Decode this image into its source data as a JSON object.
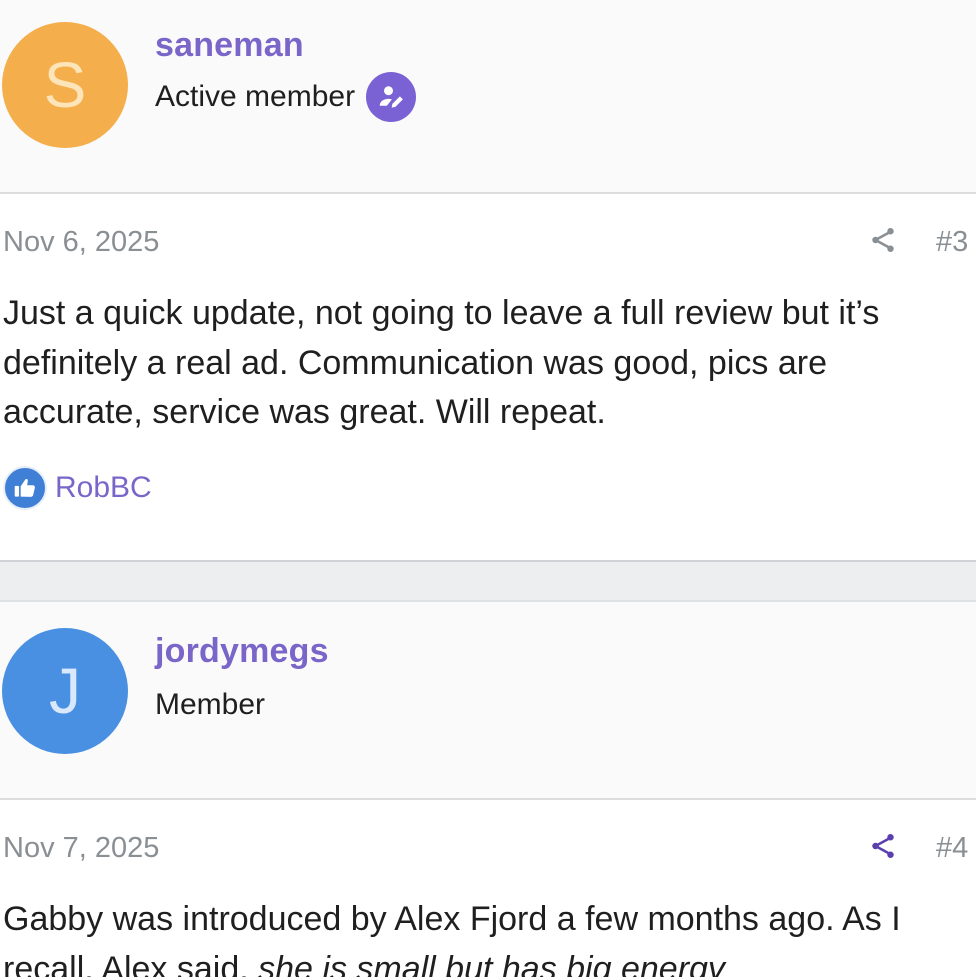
{
  "posts": [
    {
      "user": {
        "initial": "S",
        "avatar_color": "#f4ae4c",
        "avatar_text_color": "#fde5b9",
        "name": "saneman",
        "title": "Active member",
        "badge_icon": "user-edit-icon",
        "badge_color": "#7b62d4"
      },
      "date": "Nov 6, 2025",
      "share_icon": "share-icon",
      "number": "#3",
      "text_lines": [
        "Just a quick update, not going to leave a full review but it’s",
        "definitely a real ad. Communication was good, pics are",
        "accurate, service was great. Will repeat."
      ],
      "reaction": {
        "icon": "thumbs-up-icon",
        "user": "RobBC"
      }
    },
    {
      "user": {
        "initial": "J",
        "avatar_color": "#4a90e2",
        "avatar_text_color": "#d9e8fb",
        "name": "jordymegs",
        "title": "Member"
      },
      "date": "Nov 7, 2025",
      "share_icon": "share-icon",
      "number": "#4",
      "text_line_1": "Gabby was introduced by Alex Fjord a few months ago. As I",
      "text_line_2_start": "recall, Alex said, ",
      "text_line_2_italic": "she is small but has big energy"
    }
  ],
  "colors": {
    "link_purple": "#7a65c9",
    "meta_gray": "#8a8f94",
    "share_active": "#5b3fb0"
  }
}
